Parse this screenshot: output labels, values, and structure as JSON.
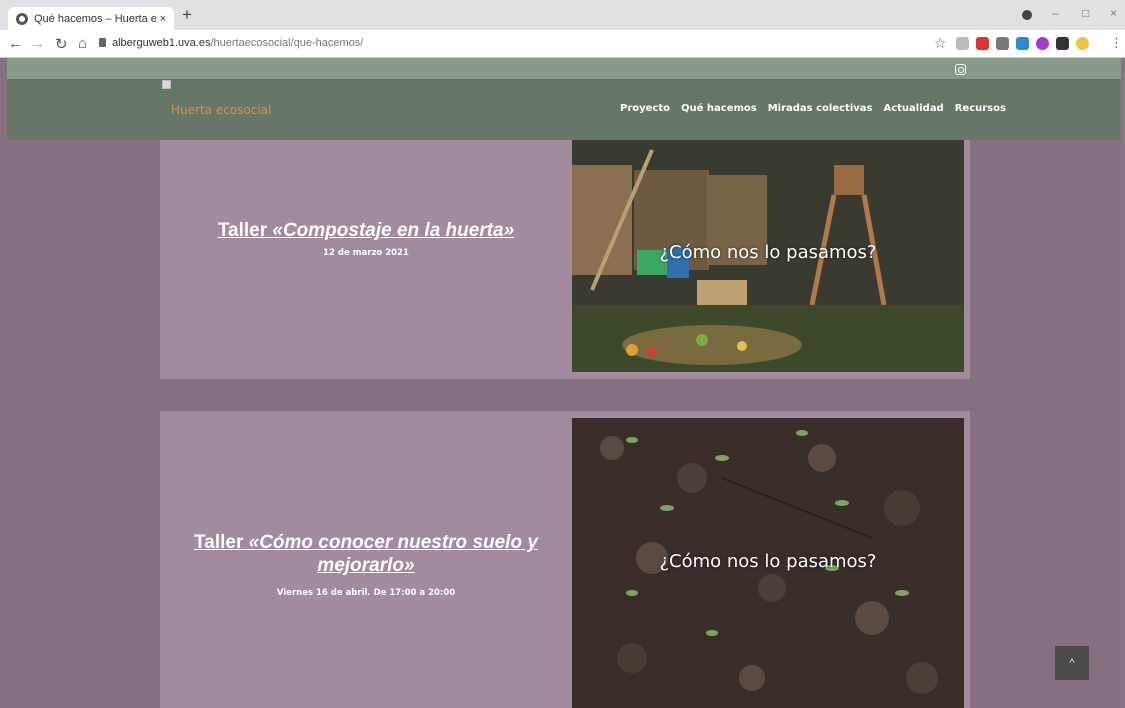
{
  "browser": {
    "tab_title": "Qué hacemos – Huerta ecosocial",
    "tab_close": "×",
    "new_tab": "+",
    "url_host": "alberguweb1.uva.es",
    "url_path": "/huertaecosocial/que-hacemos/",
    "min": "–",
    "restore": "□",
    "close": "×"
  },
  "site": {
    "title": "Huerta ecosocial",
    "menu": [
      "Proyecto",
      "Qué hacemos",
      "Miradas colectivas",
      "Actualidad",
      "Recursos"
    ]
  },
  "events": [
    {
      "title_prefix": "Taller ",
      "title_em": "«Compostaje en la huerta»",
      "date": "12 de marzo 2021",
      "overlay": "¿Cómo nos lo pasamos?"
    },
    {
      "title_prefix": "Taller ",
      "title_em": "«Cómo conocer nuestro suelo y mejorarlo»",
      "date": "Viernes 16 de abril. De 17:00 a 20:00",
      "overlay": "¿Cómo nos lo pasamos?"
    }
  ],
  "scroll_top_icon": "^",
  "colors": {
    "page_bg": "#86707f",
    "card_bg": "#a28b9c",
    "header_bg": "#677767",
    "site_title": "#e8845e"
  }
}
